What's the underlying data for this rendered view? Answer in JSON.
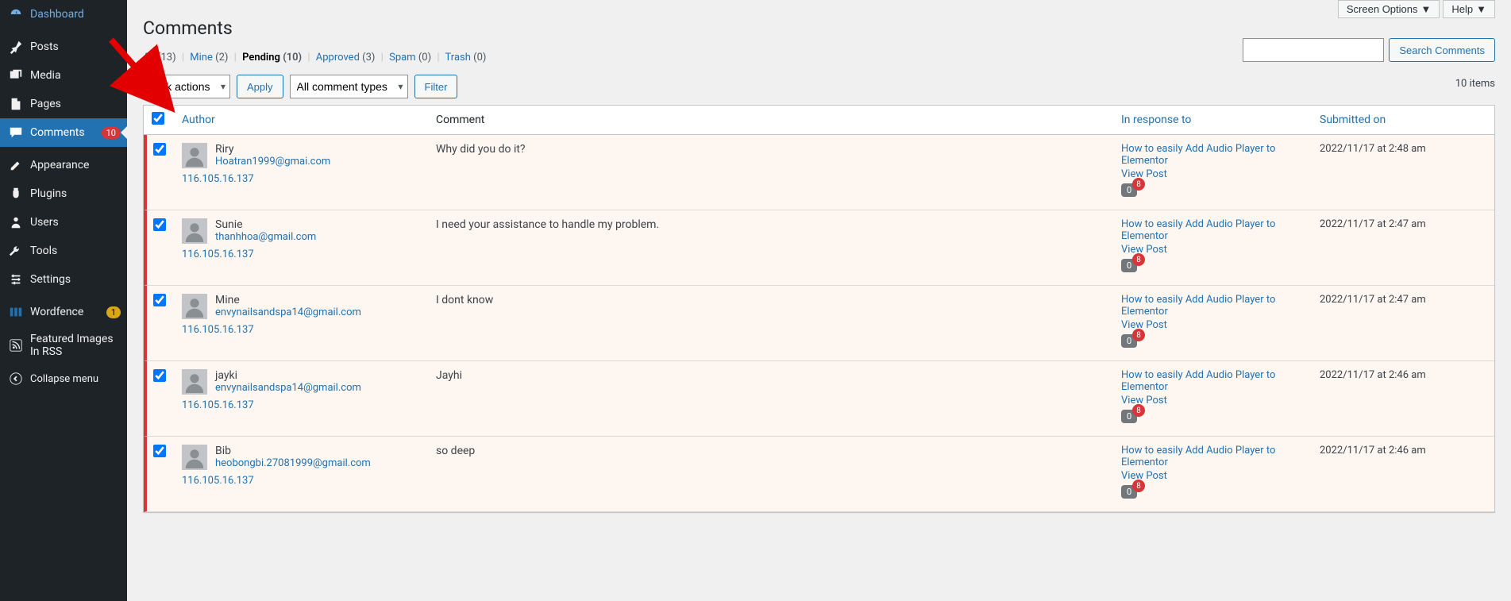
{
  "sidebar": {
    "items": [
      {
        "label": "Dashboard",
        "icon": "dashboard"
      },
      {
        "label": "Posts",
        "icon": "pin"
      },
      {
        "label": "Media",
        "icon": "media"
      },
      {
        "label": "Pages",
        "icon": "pages"
      },
      {
        "label": "Comments",
        "icon": "comment",
        "badge": "10",
        "current": true
      },
      {
        "label": "Appearance",
        "icon": "appearance"
      },
      {
        "label": "Plugins",
        "icon": "plugin"
      },
      {
        "label": "Users",
        "icon": "users"
      },
      {
        "label": "Tools",
        "icon": "tools"
      },
      {
        "label": "Settings",
        "icon": "settings"
      },
      {
        "label": "Wordfence",
        "icon": "wordfence",
        "badge": "1",
        "badgeColor": "orange"
      },
      {
        "label": "Featured Images In RSS",
        "icon": "rss"
      },
      {
        "label": "Collapse menu",
        "icon": "collapse"
      }
    ]
  },
  "topButtons": {
    "screenOptions": "Screen Options",
    "help": "Help"
  },
  "page": {
    "title": "Comments"
  },
  "filters": [
    {
      "label": "All",
      "count": "(13)"
    },
    {
      "label": "Mine",
      "count": "(2)"
    },
    {
      "label": "Pending",
      "count": "(10)",
      "current": true
    },
    {
      "label": "Approved",
      "count": "(3)"
    },
    {
      "label": "Spam",
      "count": "(0)"
    },
    {
      "label": "Trash",
      "count": "(0)"
    }
  ],
  "search": {
    "button": "Search Comments"
  },
  "actions": {
    "bulk": "Bulk actions",
    "apply": "Apply",
    "commentTypes": "All comment types",
    "filter": "Filter"
  },
  "itemsCount": "10 items",
  "table": {
    "headers": {
      "author": "Author",
      "comment": "Comment",
      "response": "In response to",
      "date": "Submitted on"
    }
  },
  "comments": [
    {
      "author": "Riry",
      "email": "Hoatran1999@gmai.com",
      "ip": "116.105.16.137",
      "content": "Why did you do it?",
      "post": "How to easily Add Audio Player to Elementor",
      "viewPost": "View Post",
      "bubbleCount": "0",
      "pendingCount": "8",
      "date": "2022/11/17 at 2:48 am"
    },
    {
      "author": "Sunie",
      "email": "thanhhoa@gmail.com",
      "ip": "116.105.16.137",
      "content": "I need your assistance to handle my problem.",
      "post": "How to easily Add Audio Player to Elementor",
      "viewPost": "View Post",
      "bubbleCount": "0",
      "pendingCount": "8",
      "date": "2022/11/17 at 2:47 am"
    },
    {
      "author": "Mine",
      "email": "envynailsandspa14@gmail.com",
      "ip": "116.105.16.137",
      "content": "I dont know",
      "post": "How to easily Add Audio Player to Elementor",
      "viewPost": "View Post",
      "bubbleCount": "0",
      "pendingCount": "8",
      "date": "2022/11/17 at 2:47 am"
    },
    {
      "author": "jayki",
      "email": "envynailsandspa14@gmail.com",
      "ip": "116.105.16.137",
      "content": "Jayhi",
      "post": "How to easily Add Audio Player to Elementor",
      "viewPost": "View Post",
      "bubbleCount": "0",
      "pendingCount": "8",
      "date": "2022/11/17 at 2:46 am"
    },
    {
      "author": "Bib",
      "email": "heobongbi.27081999@gmail.com",
      "ip": "116.105.16.137",
      "content": "so deep",
      "post": "How to easily Add Audio Player to Elementor",
      "viewPost": "View Post",
      "bubbleCount": "0",
      "pendingCount": "8",
      "date": "2022/11/17 at 2:46 am"
    }
  ]
}
